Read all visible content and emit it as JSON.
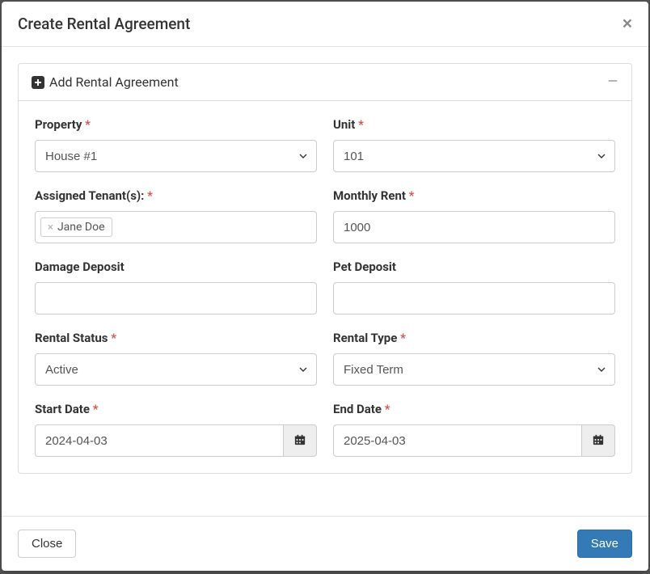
{
  "modal": {
    "title": "Create Rental Agreement",
    "panel_title": "Add Rental Agreement"
  },
  "form": {
    "property": {
      "label": "Property",
      "value": "House #1"
    },
    "unit": {
      "label": "Unit",
      "value": "101"
    },
    "tenants": {
      "label": "Assigned Tenant(s):",
      "tag_value": "Jane Doe"
    },
    "monthly_rent": {
      "label": "Monthly Rent",
      "value": "1000"
    },
    "damage_deposit": {
      "label": "Damage Deposit",
      "value": ""
    },
    "pet_deposit": {
      "label": "Pet Deposit",
      "value": ""
    },
    "rental_status": {
      "label": "Rental Status",
      "value": "Active"
    },
    "rental_type": {
      "label": "Rental Type",
      "value": "Fixed Term"
    },
    "start_date": {
      "label": "Start Date",
      "value": "2024-04-03"
    },
    "end_date": {
      "label": "End Date",
      "value": "2025-04-03"
    }
  },
  "footer": {
    "close_label": "Close",
    "save_label": "Save"
  }
}
